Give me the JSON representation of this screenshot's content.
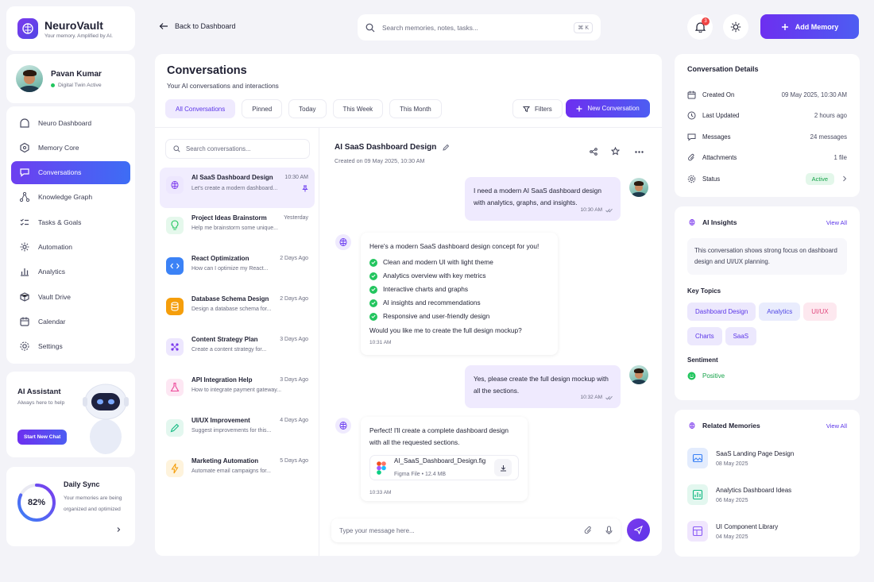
{
  "brand": {
    "name": "NeuroVault",
    "tagline": "Your memory. Amplified by AI."
  },
  "user": {
    "name": "Pavan Kumar",
    "status": "Digital Twin Active"
  },
  "nav": [
    {
      "label": "Neuro Dashboard",
      "icon": "grid-icon"
    },
    {
      "label": "Memory Core",
      "icon": "hexagon-icon"
    },
    {
      "label": "Conversations",
      "icon": "chat-icon",
      "active": true
    },
    {
      "label": "Knowledge Graph",
      "icon": "graph-icon"
    },
    {
      "label": "Tasks & Goals",
      "icon": "checklist-icon"
    },
    {
      "label": "Automation",
      "icon": "cog-icon"
    },
    {
      "label": "Analytics",
      "icon": "bar-chart-icon"
    },
    {
      "label": "Vault Drive",
      "icon": "drive-icon"
    },
    {
      "label": "Calendar",
      "icon": "calendar-icon"
    },
    {
      "label": "Settings",
      "icon": "settings-icon"
    }
  ],
  "assistant": {
    "title": "AI Assistant",
    "subtitle": "Always here to help",
    "button": "Start New Chat"
  },
  "sync": {
    "percent_label": "82%",
    "percent": 82,
    "title": "Daily Sync",
    "text": "Your memories are being organized and optimized"
  },
  "topbar": {
    "back_label": "Back to Dashboard",
    "search_placeholder": "Search memories, notes, tasks...",
    "shortcut": "⌘ K",
    "notifications": "3",
    "add_label": "Add Memory"
  },
  "conversations": {
    "title": "Conversations",
    "subtitle": "Your AI conversations and interactions",
    "tabs": [
      "All Conversations",
      "Pinned",
      "Today",
      "This Week",
      "This Month"
    ],
    "filters_label": "Filters",
    "new_label": "New Conversation",
    "list_search_placeholder": "Search conversations...",
    "items": [
      {
        "title": "AI SaaS Dashboard Design",
        "time": "10:30 AM",
        "preview": "Let's create a modern dashboard...",
        "color": "#7c3aed",
        "bg": "#ede7fe",
        "icon": "brain-icon",
        "active": true
      },
      {
        "title": "Project Ideas Brainstorm",
        "time": "Yesterday",
        "preview": "Help me brainstorm some unique...",
        "color": "#22c55e",
        "bg": "#e5f8ec",
        "icon": "lightbulb-icon"
      },
      {
        "title": "React Optimization",
        "time": "2 Days Ago",
        "preview": "How can I optimize my React...",
        "color": "#fff",
        "bg": "#3b82f6",
        "icon": "code-icon"
      },
      {
        "title": "Database Schema Design",
        "time": "2 Days Ago",
        "preview": "Design a database schema for...",
        "color": "#fff",
        "bg": "#f59e0b",
        "icon": "database-icon"
      },
      {
        "title": "Content Strategy Plan",
        "time": "3 Days Ago",
        "preview": "Create a content strategy for...",
        "color": "#7c3aed",
        "bg": "#ede7fe",
        "icon": "nodes-icon"
      },
      {
        "title": "API Integration Help",
        "time": "3 Days Ago",
        "preview": "How to integrate payment gateway...",
        "color": "#ec4899",
        "bg": "#fde7f3",
        "icon": "flask-icon"
      },
      {
        "title": "UI/UX Improvement",
        "time": "4 Days Ago",
        "preview": "Suggest improvements for this...",
        "color": "#10b981",
        "bg": "#e3f7ef",
        "icon": "pen-icon"
      },
      {
        "title": "Marketing Automation",
        "time": "5 Days Ago",
        "preview": "Automate email campaigns for...",
        "color": "#f59e0b",
        "bg": "#fef3dc",
        "icon": "bolt-icon"
      }
    ]
  },
  "chat": {
    "title": "AI SaaS Dashboard Design",
    "created": "Created on 09 May 2025, 10:30 AM",
    "msg1": {
      "text": "I need a modern AI SaaS dashboard design with analytics, graphs, and insights.",
      "time": "10:30 AM"
    },
    "msg2": {
      "intro": "Here's a modern SaaS dashboard design concept for you!",
      "points": [
        "Clean and modern UI with light theme",
        "Analytics overview with key metrics",
        "Interactive charts and graphs",
        "AI insights and recommendations",
        "Responsive and user-friendly design"
      ],
      "question": "Would you like me to create the full design mockup?",
      "time": "10:31 AM"
    },
    "msg3": {
      "text": "Yes, please create the full design mockup with all the sections.",
      "time": "10:32 AM"
    },
    "msg4": {
      "text": "Perfect! I'll create a complete dashboard design with all the requested sections.",
      "file_name": "AI_SaaS_Dashboard_Design.fig",
      "file_meta": "Figma File • 12.4 MB",
      "time": "10:33 AM"
    },
    "input_placeholder": "Type your message here..."
  },
  "details": {
    "title": "Conversation Details",
    "rows": [
      {
        "label": "Created On",
        "value": "09 May 2025, 10:30 AM",
        "icon": "calendar-icon"
      },
      {
        "label": "Last Updated",
        "value": "2 hours ago",
        "icon": "clock-icon"
      },
      {
        "label": "Messages",
        "value": "24 messages",
        "icon": "chat-icon"
      },
      {
        "label": "Attachments",
        "value": "1 file",
        "icon": "paperclip-icon"
      },
      {
        "label": "Status",
        "value": "Active",
        "icon": "settings-icon"
      }
    ]
  },
  "insights": {
    "title": "AI Insights",
    "view_all": "View All",
    "summary": "This conversation shows strong focus on dashboard design and UI/UX planning.",
    "topics_label": "Key Topics",
    "topics": [
      {
        "label": "Dashboard Design",
        "bg": "#ece8fd",
        "color": "#5b35e8"
      },
      {
        "label": "Analytics",
        "bg": "#e9ecfd",
        "color": "#4f46e5"
      },
      {
        "label": "UI/UX",
        "bg": "#fde8ef",
        "color": "#e0457b"
      },
      {
        "label": "Charts",
        "bg": "#ece8fd",
        "color": "#5b35e8"
      },
      {
        "label": "SaaS",
        "bg": "#ece8fd",
        "color": "#5b35e8"
      }
    ],
    "sentiment_label": "Sentiment",
    "sentiment": "Positive"
  },
  "related": {
    "title": "Related Memories",
    "view_all": "View All",
    "items": [
      {
        "title": "SaaS Landing Page Design",
        "date": "08 May 2025",
        "bg": "#e3ecfd",
        "color": "#3b82f6",
        "icon": "image-icon"
      },
      {
        "title": "Analytics Dashboard Ideas",
        "date": "06 May 2025",
        "bg": "#e3f7ef",
        "color": "#10b981",
        "icon": "chart-icon"
      },
      {
        "title": "UI Component Library",
        "date": "04 May 2025",
        "bg": "#f0e6fd",
        "color": "#8b5cf6",
        "icon": "layout-icon"
      }
    ]
  }
}
